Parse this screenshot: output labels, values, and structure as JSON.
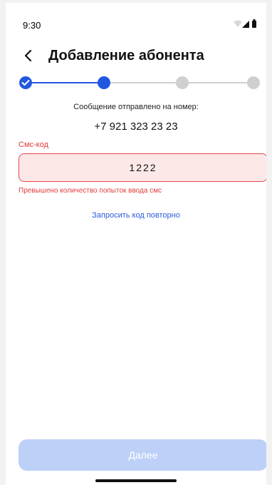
{
  "status_bar": {
    "time": "9:30",
    "icons": [
      "wifi-icon",
      "signal-icon",
      "battery-icon"
    ]
  },
  "header": {
    "back_icon": "chevron-left-icon",
    "title": "Добавление абонента"
  },
  "stepper": {
    "steps": [
      {
        "state": "completed",
        "icon": "check-icon"
      },
      {
        "state": "active"
      },
      {
        "state": "inactive"
      },
      {
        "state": "inactive"
      }
    ],
    "colors": {
      "active": "#2158e0",
      "inactive": "#cfcfcf"
    }
  },
  "verification": {
    "message": "Сообщение отправлено на номер:",
    "phone_number": "+7 921 323 23 23",
    "sms_label": "Смс-код",
    "sms_value": "1222",
    "error": "Превышено количество попыток ввода смс",
    "resend_label": "Запросить код повторно"
  },
  "footer": {
    "next_label": "Далее",
    "next_enabled": false
  },
  "colors": {
    "error": "#e23b3b",
    "link": "#2a5bd7",
    "button_disabled": "#bdd0f8"
  }
}
